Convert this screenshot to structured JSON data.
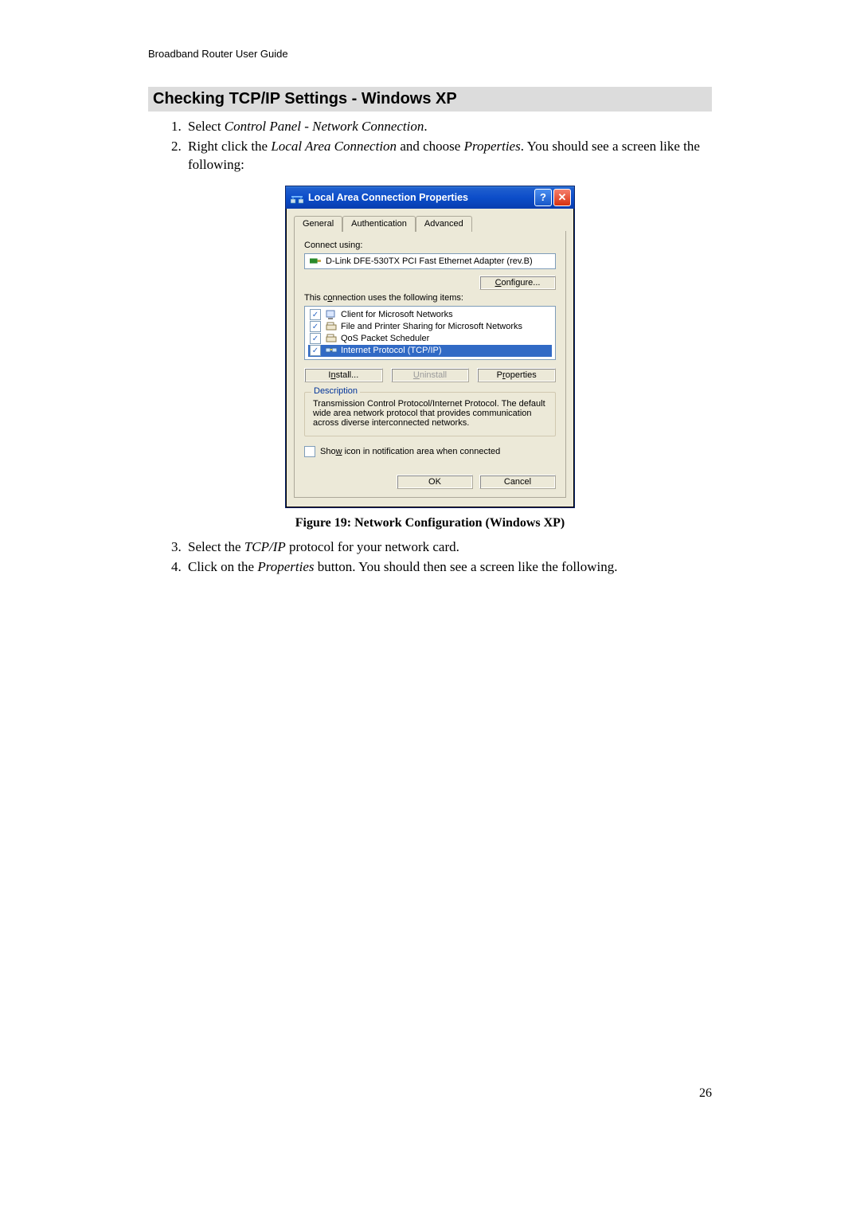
{
  "doc": {
    "running_header": "Broadband Router User Guide",
    "section_title": "Checking TCP/IP Settings - Windows XP",
    "steps_top": [
      {
        "pre": "Select ",
        "em": "Control Panel - Network Connection",
        "post": "."
      },
      {
        "pre": "Right click the ",
        "em": "Local Area Connection",
        "mid": " and choose ",
        "em2": "Properties",
        "post": ". You should see a screen like the following:"
      }
    ],
    "figure_caption": "Figure 19: Network Configuration (Windows  XP)",
    "steps_bottom": [
      {
        "pre": "Select the ",
        "em": "TCP/IP",
        "post": " protocol for your network card."
      },
      {
        "pre": "Click on the ",
        "em": "Properties",
        "post": " button. You should then see a screen like the following."
      }
    ],
    "page_number": "26"
  },
  "dialog": {
    "title": "Local Area Connection Properties",
    "tabs": [
      "General",
      "Authentication",
      "Advanced"
    ],
    "connect_label": "Connect using:",
    "adapter": "D-Link DFE-530TX PCI Fast Ethernet Adapter (rev.B)",
    "configure_btn": "Configure...",
    "uses_label": "This connection uses the following items:",
    "items": [
      {
        "checked": true,
        "name": "Client for Microsoft Networks",
        "selected": false
      },
      {
        "checked": true,
        "name": "File and Printer Sharing for Microsoft Networks",
        "selected": false
      },
      {
        "checked": true,
        "name": "QoS Packet Scheduler",
        "selected": false
      },
      {
        "checked": true,
        "name": "Internet Protocol (TCP/IP)",
        "selected": true
      }
    ],
    "buttons": {
      "install": "Install...",
      "uninstall": "Uninstall",
      "properties": "Properties"
    },
    "description_label": "Description",
    "description_text": "Transmission Control Protocol/Internet Protocol. The default wide area network protocol that provides communication across diverse interconnected networks.",
    "show_icon_label": "Show icon in notification area when connected",
    "ok": "OK",
    "cancel": "Cancel"
  }
}
